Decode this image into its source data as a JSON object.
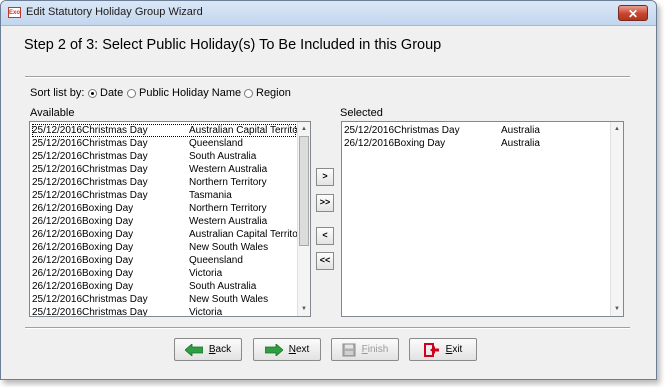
{
  "window": {
    "title": "Edit Statutory Holiday Group Wizard",
    "app_icon_text": "Exo",
    "close_glyph": "✕"
  },
  "heading": "Step 2 of 3: Select Public Holiday(s) To Be Included in this Group",
  "sort": {
    "label": "Sort list by:",
    "options": [
      {
        "label": "Date",
        "selected": true
      },
      {
        "label": "Public Holiday Name",
        "selected": false
      },
      {
        "label": "Region",
        "selected": false
      }
    ]
  },
  "available": {
    "label": "Available",
    "rows": [
      {
        "date": "25/12/2016",
        "name": "Christmas Day",
        "region": "Australian Capital Territory"
      },
      {
        "date": "25/12/2016",
        "name": "Christmas Day",
        "region": "Queensland"
      },
      {
        "date": "25/12/2016",
        "name": "Christmas Day",
        "region": "South Australia"
      },
      {
        "date": "25/12/2016",
        "name": "Christmas Day",
        "region": "Western Australia"
      },
      {
        "date": "25/12/2016",
        "name": "Christmas Day",
        "region": "Northern Territory"
      },
      {
        "date": "25/12/2016",
        "name": "Christmas Day",
        "region": "Tasmania"
      },
      {
        "date": "26/12/2016",
        "name": "Boxing Day",
        "region": "Northern Territory"
      },
      {
        "date": "26/12/2016",
        "name": "Boxing Day",
        "region": "Western Australia"
      },
      {
        "date": "26/12/2016",
        "name": "Boxing Day",
        "region": "Australian Capital Territory"
      },
      {
        "date": "26/12/2016",
        "name": "Boxing Day",
        "region": "New South Wales"
      },
      {
        "date": "26/12/2016",
        "name": "Boxing Day",
        "region": "Queensland"
      },
      {
        "date": "26/12/2016",
        "name": "Boxing Day",
        "region": "Victoria"
      },
      {
        "date": "26/12/2016",
        "name": "Boxing Day",
        "region": "South Australia"
      },
      {
        "date": "25/12/2016",
        "name": "Christmas Day",
        "region": "New South Wales"
      },
      {
        "date": "25/12/2016",
        "name": "Christmas Day",
        "region": "Victoria"
      }
    ]
  },
  "selected": {
    "label": "Selected",
    "rows": [
      {
        "date": "25/12/2016",
        "name": "Christmas Day",
        "region": "Australia"
      },
      {
        "date": "26/12/2016",
        "name": "Boxing Day",
        "region": "Australia"
      }
    ]
  },
  "move_buttons": {
    "add": ">",
    "add_all": ">>",
    "remove": "<",
    "remove_all": "<<"
  },
  "scroll_arrows": {
    "up": "▲",
    "down": "▼"
  },
  "footer": {
    "back": {
      "key": "B",
      "rest": "ack"
    },
    "next": {
      "key": "N",
      "rest": "ext"
    },
    "finish": {
      "key": "F",
      "rest": "inish"
    },
    "exit": {
      "key": "E",
      "rest": "xit"
    }
  },
  "colors": {
    "arrow_green": "#2ea043",
    "exit_red": "#d0021b",
    "title_bar": "#c9dbf1"
  }
}
